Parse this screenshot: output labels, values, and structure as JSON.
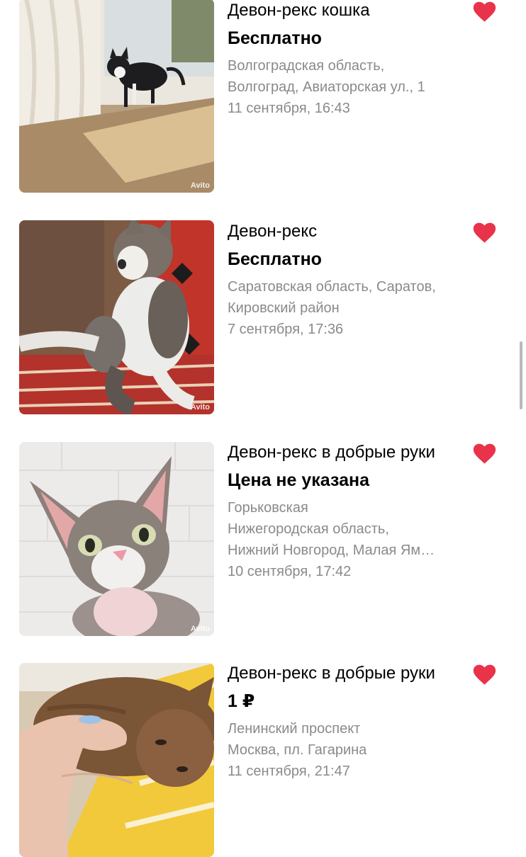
{
  "colors": {
    "favorite": "#e8334a",
    "meta_text": "#8a8a8a",
    "title_text": "#000000"
  },
  "listings": [
    {
      "title": "Девон-рекс кошка",
      "price": "Бесплатно",
      "address_lines": [
        "Волгоградская область,",
        "Волгоград, Авиаторская ул., 1"
      ],
      "date": "11 сентября, 16:43",
      "photo_watermark": "Avito",
      "favorite_icon": "heart-icon"
    },
    {
      "title": "Девон-рекс",
      "price": "Бесплатно",
      "address_lines": [
        "Саратовская область, Саратов,",
        "Кировский район"
      ],
      "date": "7 сентября, 17:36",
      "photo_watermark": "Avito",
      "favorite_icon": "heart-icon"
    },
    {
      "title": "Девон-рекс в добрые руки",
      "price": "Цена не указана",
      "address_lines": [
        "Горьковская",
        "Нижегородская область,",
        "Нижний Новгород, Малая Ям…"
      ],
      "date": "10 сентября, 17:42",
      "photo_watermark": "Avito",
      "favorite_icon": "heart-icon"
    },
    {
      "title": "Девон-рекс в добрые руки",
      "price": "1 ₽",
      "address_lines": [
        "Ленинский проспект",
        "Москва, пл. Гагарина"
      ],
      "date": "11 сентября, 21:47",
      "photo_watermark": "",
      "favorite_icon": "heart-icon"
    }
  ]
}
